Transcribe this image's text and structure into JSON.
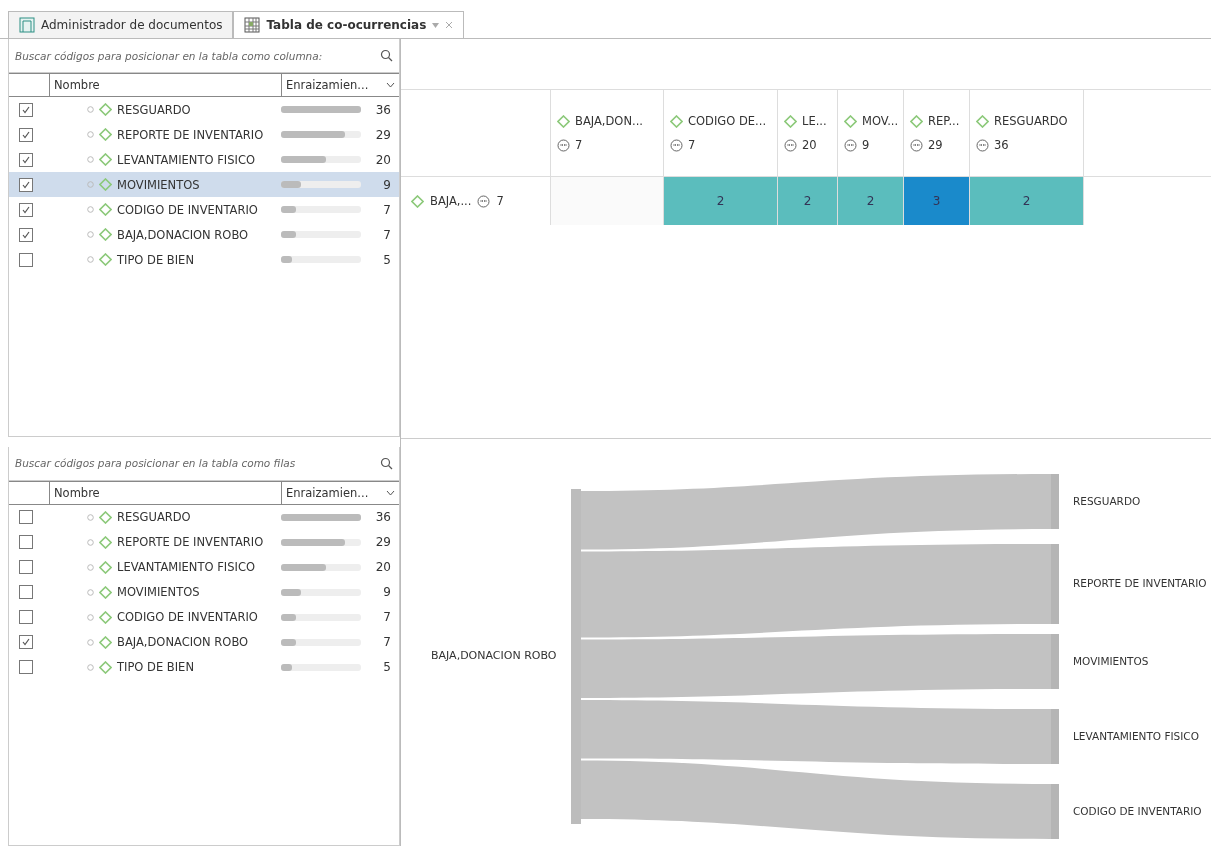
{
  "tabs": [
    {
      "label": "Administrador de documentos",
      "selected": false
    },
    {
      "label": "Tabla de co-ocurrencias",
      "selected": true
    }
  ],
  "column_list": {
    "placeholder": "Buscar códigos para posicionar en la tabla como columna:",
    "columns": [
      "Nombre",
      "Enraizamien..."
    ],
    "rows": [
      {
        "name": "RESGUARDO",
        "count": "36",
        "level": 1,
        "checked": true,
        "selected": false
      },
      {
        "name": "REPORTE DE INVENTARIO",
        "count": "29",
        "level": 0.8,
        "checked": true,
        "selected": false
      },
      {
        "name": "LEVANTAMIENTO FISICO",
        "count": "20",
        "level": 0.56,
        "checked": true,
        "selected": false
      },
      {
        "name": "MOVIMIENTOS",
        "count": "9",
        "level": 0.25,
        "checked": true,
        "selected": true
      },
      {
        "name": "CODIGO DE INVENTARIO",
        "count": "7",
        "level": 0.19,
        "checked": true,
        "selected": false
      },
      {
        "name": "BAJA,DONACION ROBO",
        "count": "7",
        "level": 0.19,
        "checked": true,
        "selected": false
      },
      {
        "name": "TIPO DE BIEN",
        "count": "5",
        "level": 0.14,
        "checked": false,
        "selected": false
      }
    ]
  },
  "row_list": {
    "placeholder": "Buscar códigos para posicionar en la tabla como filas",
    "columns": [
      "Nombre",
      "Enraizamien..."
    ],
    "rows": [
      {
        "name": "RESGUARDO",
        "count": "36",
        "level": 1,
        "checked": false,
        "selected": false
      },
      {
        "name": "REPORTE DE INVENTARIO",
        "count": "29",
        "level": 0.8,
        "checked": false,
        "selected": false
      },
      {
        "name": "LEVANTAMIENTO FISICO",
        "count": "20",
        "level": 0.56,
        "checked": false,
        "selected": false
      },
      {
        "name": "MOVIMIENTOS",
        "count": "9",
        "level": 0.25,
        "checked": false,
        "selected": false
      },
      {
        "name": "CODIGO DE INVENTARIO",
        "count": "7",
        "level": 0.19,
        "checked": false,
        "selected": false
      },
      {
        "name": "BAJA,DONACION ROBO",
        "count": "7",
        "level": 0.19,
        "checked": true,
        "selected": false
      },
      {
        "name": "TIPO DE BIEN",
        "count": "5",
        "level": 0.14,
        "checked": false,
        "selected": false
      }
    ]
  },
  "matrix": {
    "columns": [
      {
        "name": "BAJA,DON...",
        "count": "7"
      },
      {
        "name": "CODIGO DE...",
        "count": "7"
      },
      {
        "name": "LE...",
        "count": "20"
      },
      {
        "name": "MOV...",
        "count": "9"
      },
      {
        "name": "REP...",
        "count": "29"
      },
      {
        "name": "RESGUARDO",
        "count": "36"
      }
    ],
    "rows": [
      {
        "name": "BAJA,...",
        "count": "7",
        "cells": [
          {
            "kind": "empty"
          },
          {
            "kind": "value",
            "value": "2",
            "color": "#5bbdbd"
          },
          {
            "kind": "value",
            "value": "2",
            "color": "#5bbdbd"
          },
          {
            "kind": "value",
            "value": "2",
            "color": "#5bbdbd"
          },
          {
            "kind": "value",
            "value": "3",
            "color": "#1a8acb"
          },
          {
            "kind": "value",
            "value": "2",
            "color": "#5bbdbd"
          }
        ]
      }
    ]
  },
  "sankey": {
    "source": "BAJA,DONACION ROBO",
    "targets": [
      "RESGUARDO",
      "REPORTE DE INVENTARIO",
      "MOVIMIENTOS",
      "LEVANTAMIENTO FISICO",
      "CODIGO DE INVENTARIO"
    ]
  }
}
